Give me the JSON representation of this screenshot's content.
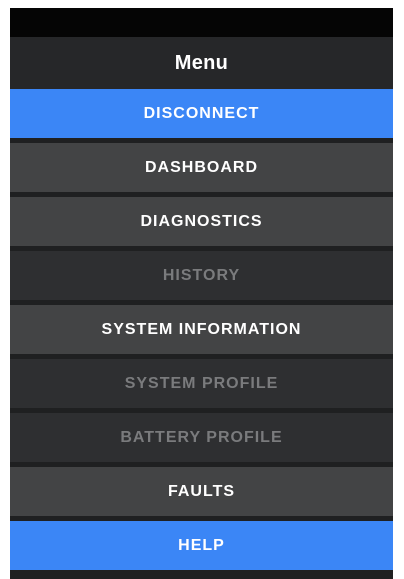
{
  "header": {
    "title": "Menu"
  },
  "menu": {
    "items": [
      {
        "label": "DISCONNECT",
        "variant": "blue"
      },
      {
        "label": "DASHBOARD",
        "variant": "active"
      },
      {
        "label": "DIAGNOSTICS",
        "variant": "active"
      },
      {
        "label": "HISTORY",
        "variant": "disabled"
      },
      {
        "label": "SYSTEM INFORMATION",
        "variant": "active"
      },
      {
        "label": "SYSTEM PROFILE",
        "variant": "disabled"
      },
      {
        "label": "BATTERY PROFILE",
        "variant": "disabled"
      },
      {
        "label": "FAULTS",
        "variant": "active"
      },
      {
        "label": "HELP",
        "variant": "blue"
      }
    ]
  },
  "colors": {
    "accent": "#3b86f6",
    "item_enabled": "#434445",
    "item_disabled": "#2e2f31",
    "text_disabled": "#7a7b7d",
    "header_bg": "#262729"
  }
}
